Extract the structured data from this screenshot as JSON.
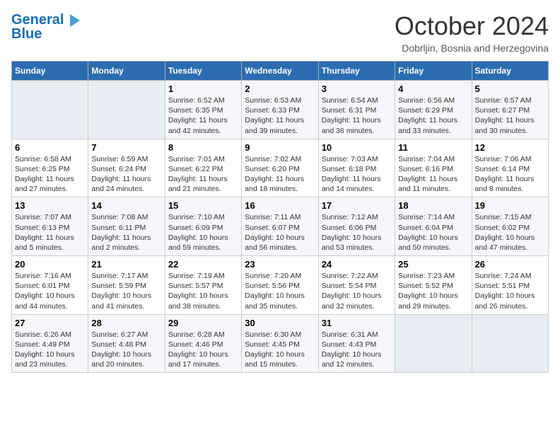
{
  "header": {
    "logo_line1": "General",
    "logo_line2": "Blue",
    "month": "October 2024",
    "location": "Dobrljin, Bosnia and Herzegovina"
  },
  "weekdays": [
    "Sunday",
    "Monday",
    "Tuesday",
    "Wednesday",
    "Thursday",
    "Friday",
    "Saturday"
  ],
  "weeks": [
    [
      {
        "day": "",
        "empty": true
      },
      {
        "day": "",
        "empty": true
      },
      {
        "day": "1",
        "sunrise": "Sunrise: 6:52 AM",
        "sunset": "Sunset: 6:35 PM",
        "daylight": "Daylight: 11 hours and 42 minutes."
      },
      {
        "day": "2",
        "sunrise": "Sunrise: 6:53 AM",
        "sunset": "Sunset: 6:33 PM",
        "daylight": "Daylight: 11 hours and 39 minutes."
      },
      {
        "day": "3",
        "sunrise": "Sunrise: 6:54 AM",
        "sunset": "Sunset: 6:31 PM",
        "daylight": "Daylight: 11 hours and 36 minutes."
      },
      {
        "day": "4",
        "sunrise": "Sunrise: 6:56 AM",
        "sunset": "Sunset: 6:29 PM",
        "daylight": "Daylight: 11 hours and 33 minutes."
      },
      {
        "day": "5",
        "sunrise": "Sunrise: 6:57 AM",
        "sunset": "Sunset: 6:27 PM",
        "daylight": "Daylight: 11 hours and 30 minutes."
      }
    ],
    [
      {
        "day": "6",
        "sunrise": "Sunrise: 6:58 AM",
        "sunset": "Sunset: 6:25 PM",
        "daylight": "Daylight: 11 hours and 27 minutes."
      },
      {
        "day": "7",
        "sunrise": "Sunrise: 6:59 AM",
        "sunset": "Sunset: 6:24 PM",
        "daylight": "Daylight: 11 hours and 24 minutes."
      },
      {
        "day": "8",
        "sunrise": "Sunrise: 7:01 AM",
        "sunset": "Sunset: 6:22 PM",
        "daylight": "Daylight: 11 hours and 21 minutes."
      },
      {
        "day": "9",
        "sunrise": "Sunrise: 7:02 AM",
        "sunset": "Sunset: 6:20 PM",
        "daylight": "Daylight: 11 hours and 18 minutes."
      },
      {
        "day": "10",
        "sunrise": "Sunrise: 7:03 AM",
        "sunset": "Sunset: 6:18 PM",
        "daylight": "Daylight: 11 hours and 14 minutes."
      },
      {
        "day": "11",
        "sunrise": "Sunrise: 7:04 AM",
        "sunset": "Sunset: 6:16 PM",
        "daylight": "Daylight: 11 hours and 11 minutes."
      },
      {
        "day": "12",
        "sunrise": "Sunrise: 7:06 AM",
        "sunset": "Sunset: 6:14 PM",
        "daylight": "Daylight: 11 hours and 8 minutes."
      }
    ],
    [
      {
        "day": "13",
        "sunrise": "Sunrise: 7:07 AM",
        "sunset": "Sunset: 6:13 PM",
        "daylight": "Daylight: 11 hours and 5 minutes."
      },
      {
        "day": "14",
        "sunrise": "Sunrise: 7:08 AM",
        "sunset": "Sunset: 6:11 PM",
        "daylight": "Daylight: 11 hours and 2 minutes."
      },
      {
        "day": "15",
        "sunrise": "Sunrise: 7:10 AM",
        "sunset": "Sunset: 6:09 PM",
        "daylight": "Daylight: 10 hours and 59 minutes."
      },
      {
        "day": "16",
        "sunrise": "Sunrise: 7:11 AM",
        "sunset": "Sunset: 6:07 PM",
        "daylight": "Daylight: 10 hours and 56 minutes."
      },
      {
        "day": "17",
        "sunrise": "Sunrise: 7:12 AM",
        "sunset": "Sunset: 6:06 PM",
        "daylight": "Daylight: 10 hours and 53 minutes."
      },
      {
        "day": "18",
        "sunrise": "Sunrise: 7:14 AM",
        "sunset": "Sunset: 6:04 PM",
        "daylight": "Daylight: 10 hours and 50 minutes."
      },
      {
        "day": "19",
        "sunrise": "Sunrise: 7:15 AM",
        "sunset": "Sunset: 6:02 PM",
        "daylight": "Daylight: 10 hours and 47 minutes."
      }
    ],
    [
      {
        "day": "20",
        "sunrise": "Sunrise: 7:16 AM",
        "sunset": "Sunset: 6:01 PM",
        "daylight": "Daylight: 10 hours and 44 minutes."
      },
      {
        "day": "21",
        "sunrise": "Sunrise: 7:17 AM",
        "sunset": "Sunset: 5:59 PM",
        "daylight": "Daylight: 10 hours and 41 minutes."
      },
      {
        "day": "22",
        "sunrise": "Sunrise: 7:19 AM",
        "sunset": "Sunset: 5:57 PM",
        "daylight": "Daylight: 10 hours and 38 minutes."
      },
      {
        "day": "23",
        "sunrise": "Sunrise: 7:20 AM",
        "sunset": "Sunset: 5:56 PM",
        "daylight": "Daylight: 10 hours and 35 minutes."
      },
      {
        "day": "24",
        "sunrise": "Sunrise: 7:22 AM",
        "sunset": "Sunset: 5:54 PM",
        "daylight": "Daylight: 10 hours and 32 minutes."
      },
      {
        "day": "25",
        "sunrise": "Sunrise: 7:23 AM",
        "sunset": "Sunset: 5:52 PM",
        "daylight": "Daylight: 10 hours and 29 minutes."
      },
      {
        "day": "26",
        "sunrise": "Sunrise: 7:24 AM",
        "sunset": "Sunset: 5:51 PM",
        "daylight": "Daylight: 10 hours and 26 minutes."
      }
    ],
    [
      {
        "day": "27",
        "sunrise": "Sunrise: 6:26 AM",
        "sunset": "Sunset: 4:49 PM",
        "daylight": "Daylight: 10 hours and 23 minutes."
      },
      {
        "day": "28",
        "sunrise": "Sunrise: 6:27 AM",
        "sunset": "Sunset: 4:48 PM",
        "daylight": "Daylight: 10 hours and 20 minutes."
      },
      {
        "day": "29",
        "sunrise": "Sunrise: 6:28 AM",
        "sunset": "Sunset: 4:46 PM",
        "daylight": "Daylight: 10 hours and 17 minutes."
      },
      {
        "day": "30",
        "sunrise": "Sunrise: 6:30 AM",
        "sunset": "Sunset: 4:45 PM",
        "daylight": "Daylight: 10 hours and 15 minutes."
      },
      {
        "day": "31",
        "sunrise": "Sunrise: 6:31 AM",
        "sunset": "Sunset: 4:43 PM",
        "daylight": "Daylight: 10 hours and 12 minutes."
      },
      {
        "day": "",
        "empty": true
      },
      {
        "day": "",
        "empty": true
      }
    ]
  ]
}
